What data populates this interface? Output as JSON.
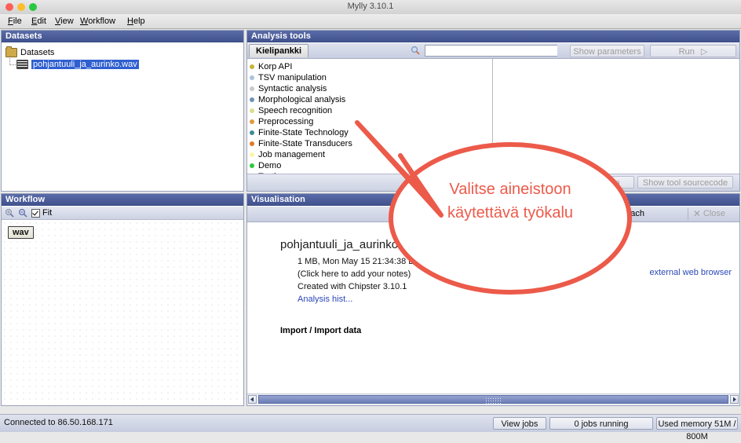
{
  "window": {
    "title": "Mylly 3.10.1",
    "traffic": [
      "close",
      "minimize",
      "zoom"
    ]
  },
  "menubar": {
    "items": [
      {
        "label": "File"
      },
      {
        "label": "Edit"
      },
      {
        "label": "View"
      },
      {
        "label": "Workflow"
      },
      {
        "label": "Help"
      }
    ]
  },
  "datasets": {
    "title": "Datasets",
    "root": "Datasets",
    "file": "pohjantuuli_ja_aurinko.wav"
  },
  "analysis": {
    "title": "Analysis tools",
    "tab": "Kielipankki",
    "search_value": "",
    "search_placeholder": "",
    "tools": [
      {
        "label": "Korp API",
        "color": "#c8b43a"
      },
      {
        "label": "TSV manipulation",
        "color": "#a8c4dd"
      },
      {
        "label": "Syntactic analysis",
        "color": "#c9c9c9"
      },
      {
        "label": "Morphological analysis",
        "color": "#6e93b3"
      },
      {
        "label": "Speech recognition",
        "color": "#dde08a"
      },
      {
        "label": "Preprocessing",
        "color": "#e09a3c"
      },
      {
        "label": "Finite-State Technology",
        "color": "#3f8c96"
      },
      {
        "label": "Finite-State Transducers",
        "color": "#e07a26"
      },
      {
        "label": "Job management",
        "color": "#fdf5a8"
      },
      {
        "label": "Demo",
        "color": "#2ec93a"
      },
      {
        "label": "Testing",
        "color": "#ef3fa0"
      }
    ],
    "show_parameters_label": "Show parameters",
    "run_label": "Run",
    "help_label": "Help",
    "sourcecode_label": "Show tool sourcecode"
  },
  "workflow": {
    "title": "Workflow",
    "zoom_in_icon": "zoom-in-icon",
    "zoom_out_icon": "zoom-out-icon",
    "fit_label": "Fit",
    "fit_checked": true,
    "node_label": "wav"
  },
  "visualisation": {
    "title": "Visualisation",
    "detach_label": "Detach",
    "close_label": "Close",
    "dataset_title": "pohjantuuli_ja_aurinko.wav",
    "size_date": "1 MB, Mon May 15 21:34:38 EEST 2017",
    "notes_hint": "(Click here to add your notes)",
    "created_with": "Created with Chipster 3.10.1",
    "history_link": "Analysis hist...",
    "import_line": "Import / Import data",
    "external_link": "external web browser"
  },
  "annotation": {
    "line1": "Valitse aineistoon",
    "line2": "käytettävä työkalu",
    "color": "#ec5a4a"
  },
  "statusbar": {
    "connection": "Connected to 86.50.168.171",
    "view_jobs": "View jobs",
    "jobs_running": "0 jobs running",
    "memory": "Used memory 51M / 800M"
  }
}
